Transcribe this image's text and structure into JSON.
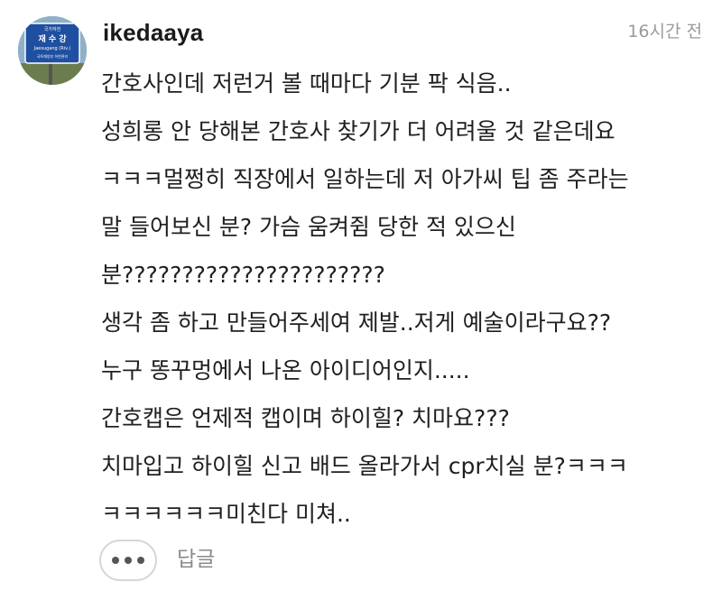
{
  "comment": {
    "avatar": {
      "icon": "road-sign-avatar-icon",
      "sign_lines": [
        "국가하천",
        "재 수 강",
        "Jaesugang (Riv.)",
        "국토해양부 하천관리"
      ]
    },
    "username": "ikedaaya",
    "timestamp": "16시간 전",
    "lines": [
      "간호사인데 저런거 볼 때마다 기분 팍 식음..",
      "성희롱 안 당해본 간호사 찾기가 더 어려울 것 같은데요",
      "ㅋㅋㅋ멀쩡히 직장에서 일하는데 저 아가씨 팁 좀 주라는",
      "말 들어보신 분? 가슴 움켜쥠 당한 적 있으신",
      "분??????????????????????",
      "생각 좀 하고 만들어주세여 제발..저게 예술이라구요??",
      "누구 똥꾸멍에서 나온 아이디어인지.....",
      "간호캡은 언제적 캡이며 하이힐? 치마요???",
      "치마입고 하이힐 신고 배드 올라가서 cpr치실 분?ㅋㅋㅋ",
      "ㅋㅋㅋㅋㅋㅋ미친다 미쳐.."
    ],
    "actions": {
      "more_icon": "more-dots-icon",
      "reply_label": "답글"
    }
  }
}
